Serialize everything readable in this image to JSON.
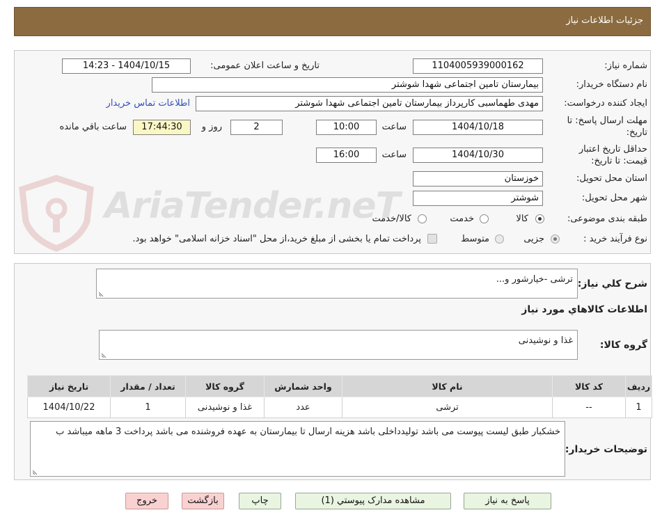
{
  "header": {
    "title": "جزئیات اطلاعات نیاز"
  },
  "watermark": {
    "text": "AriaTender.neT"
  },
  "colors": {
    "header_bg": "#8b6b3f",
    "link": "#3050b8",
    "remaining_bg": "#fbf7c4",
    "primary_button_bg": "#e9f5e1",
    "danger_button_bg": "#f9d1d1",
    "table_header_bg": "#d6d6d6"
  },
  "details": {
    "need_number": {
      "label": "شماره نیاز:",
      "value": "1104005939000162"
    },
    "announce_datetime": {
      "label": "تاریخ و ساعت اعلان عمومی:",
      "value": "1404/10/15 - 14:23"
    },
    "buyer_org": {
      "label": "نام دستگاه خریدار:",
      "value": "بیمارستان تامین اجتماعی شهدا شوشتر"
    },
    "requester": {
      "label": "ایجاد کننده درخواست:",
      "value": "مهدی طهماسبی کارپرداز بیمارستان تامین اجتماعی شهدا شوشتر",
      "contact_link": "اطلاعات تماس خریدار"
    },
    "response_deadline": {
      "label_lines": [
        "مهلت ارسال پاسخ: تا",
        "تاریخ:"
      ],
      "date": "1404/10/18",
      "time_label": "ساعت",
      "time": "10:00",
      "days": "2",
      "days_label": "روز و",
      "remaining": "17:44:30",
      "remaining_label": "ساعت باقي مانده"
    },
    "price_validity": {
      "label_lines": [
        "حداقل تاریخ اعتبار",
        "قیمت: تا تاریخ:"
      ],
      "date": "1404/10/30",
      "time_label": "ساعت",
      "time": "16:00"
    },
    "province": {
      "label": "استان محل تحویل:",
      "value": "خوزستان"
    },
    "city": {
      "label": "شهر محل تحویل:",
      "value": "شوشتر"
    },
    "category": {
      "label": "طبقه بندی موضوعی:",
      "options": [
        {
          "label": "کالا",
          "selected": true
        },
        {
          "label": "خدمت",
          "selected": false
        },
        {
          "label": "کالا/خدمت",
          "selected": false
        }
      ]
    },
    "process_type": {
      "label": "نوع فرآیند خرید :",
      "options": [
        {
          "label": "جزیی",
          "selected": true
        },
        {
          "label": "متوسط",
          "selected": false
        }
      ],
      "treasury_checkbox": {
        "label": "پرداخت تمام یا بخشی از مبلغ خرید،از محل \"اسناد خزانه اسلامی\" خواهد بود.",
        "checked": false
      }
    }
  },
  "needs": {
    "description": {
      "label": "شرح کلي نیاز:",
      "value": "ترشی -خیارشور و..."
    },
    "items_heading": "اطلاعات کالاهاي مورد نیاز",
    "goods_group": {
      "label": "گروه کالا:",
      "value": "غذا و نوشیدنی"
    },
    "table": {
      "columns": [
        "ردیف",
        "کد کالا",
        "نام کالا",
        "واحد شمارش",
        "گروه کالا",
        "تعداد / مقدار",
        "تاریخ نیاز"
      ],
      "rows": [
        [
          "1",
          "--",
          "ترشی",
          "عدد",
          "غذا و نوشیدنی",
          "1",
          "1404/10/22"
        ]
      ]
    },
    "buyer_notes": {
      "label": "توضیحات خریدار:",
      "value": "خشکبار طبق لیست پیوست می باشد تولیدداخلی باشد هزینه ارسال تا بیمارستان به عهده فروشنده می باشد پرداخت 3 ماهه میباشد ب"
    }
  },
  "buttons": {
    "respond": "پاسخ به نیاز",
    "attachments": "مشاهده مدارک پیوستي (1)",
    "print": "چاپ",
    "back": "بازگشت",
    "exit": "خروج"
  }
}
